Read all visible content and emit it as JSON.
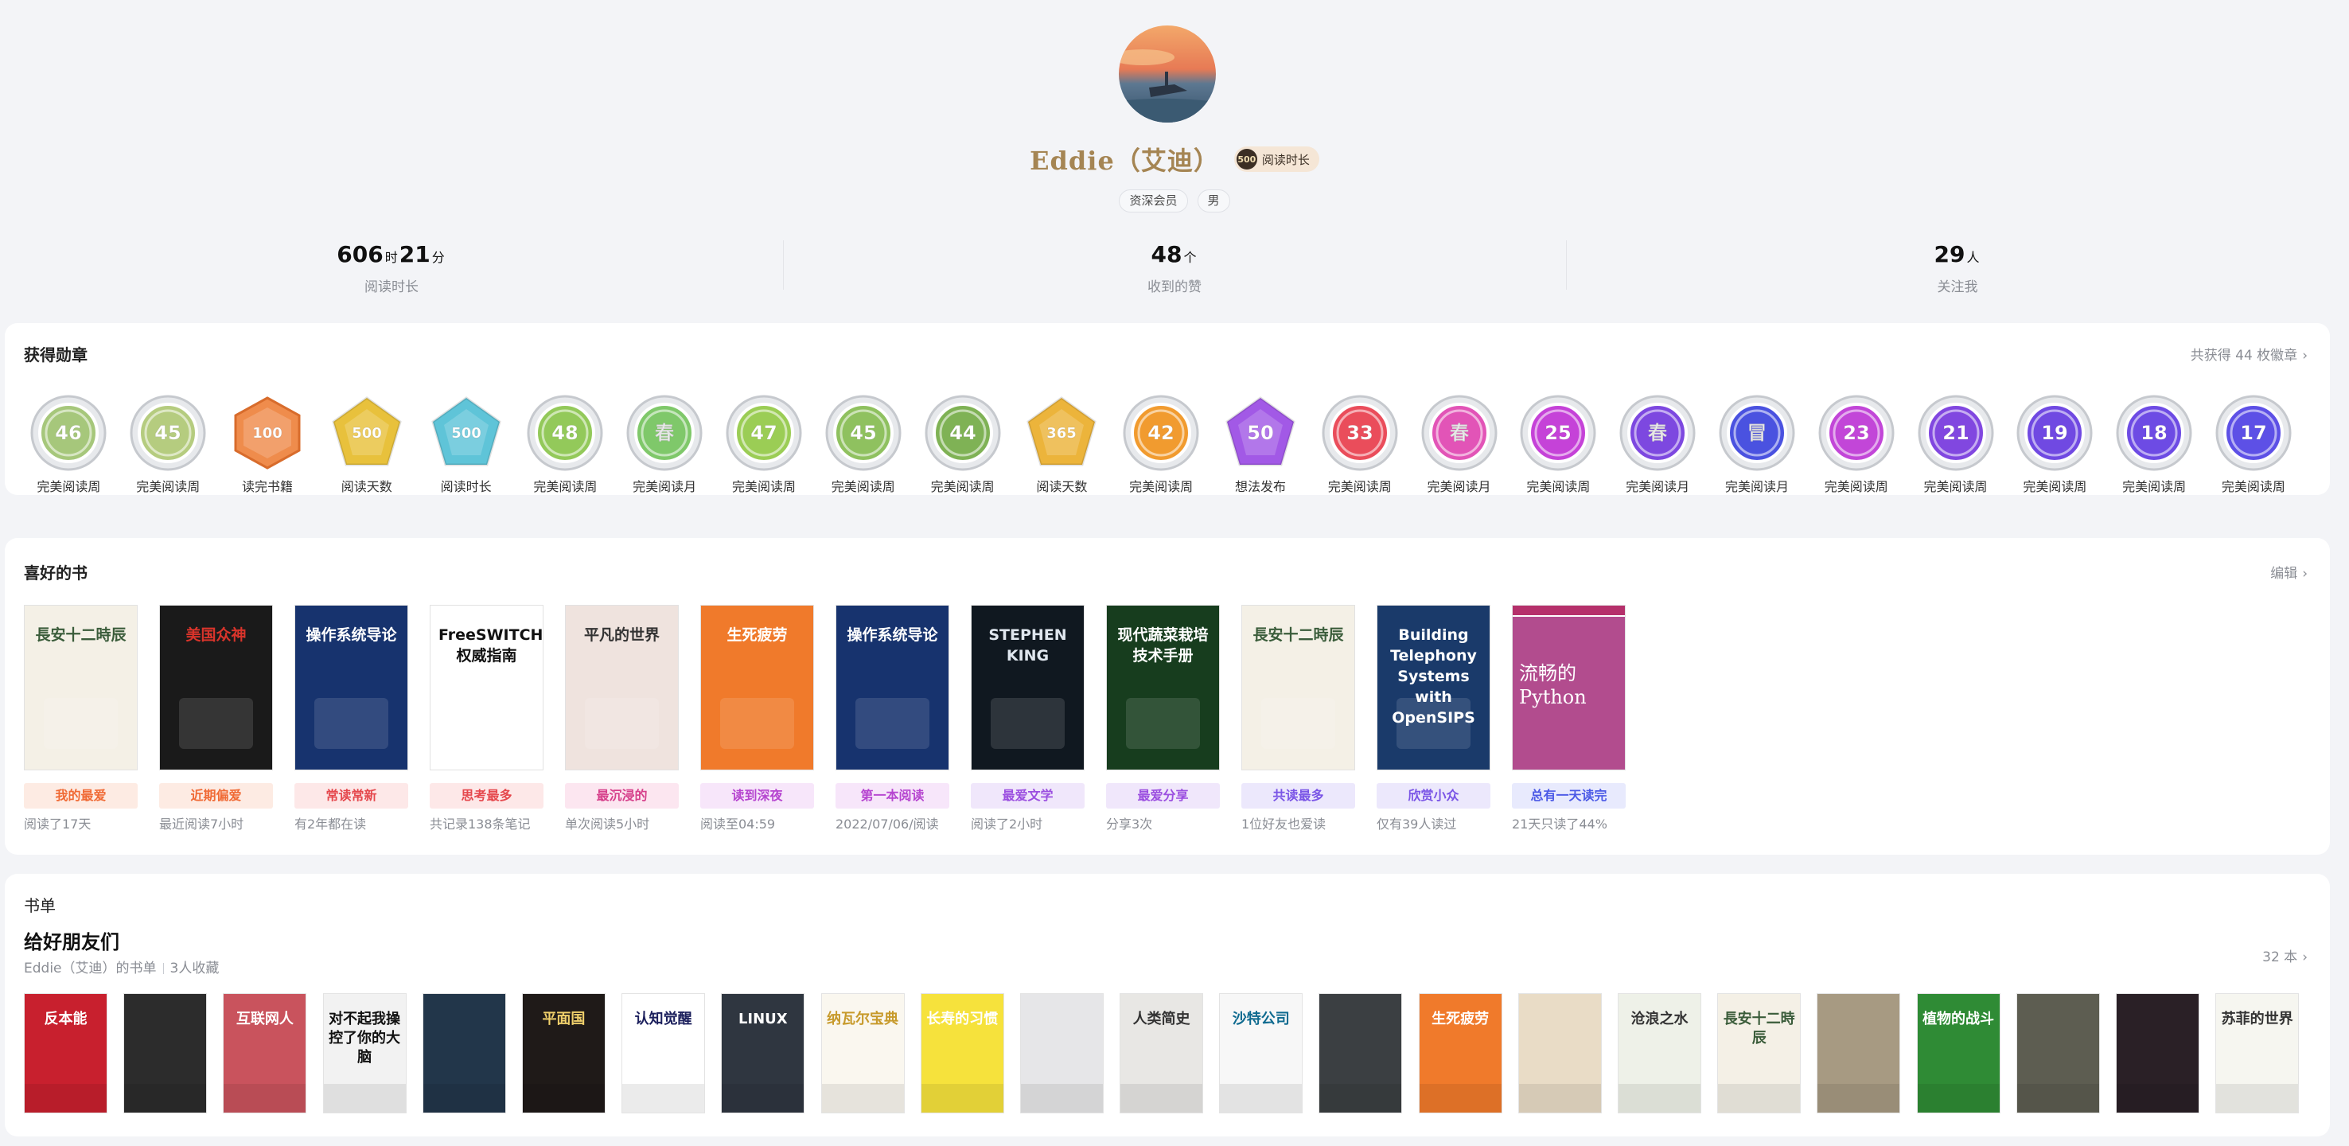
{
  "profile": {
    "name": "Eddie（艾迪）",
    "badge_number": "500",
    "badge_label": "阅读时长",
    "tags": [
      "资深会员",
      "男"
    ]
  },
  "stats": [
    {
      "parts": [
        {
          "v": "606"
        },
        {
          "u": "时"
        },
        {
          "v": "21"
        },
        {
          "u": "分"
        }
      ],
      "label": "阅读时长"
    },
    {
      "parts": [
        {
          "v": "48"
        },
        {
          "u": "个"
        }
      ],
      "label": "收到的赞"
    },
    {
      "parts": [
        {
          "v": "29"
        },
        {
          "u": "人"
        }
      ],
      "label": "关注我"
    }
  ],
  "medals_section": {
    "title": "获得勋章",
    "link": "共获得 44 枚徽章",
    "items": [
      {
        "text": "46",
        "label": "完美阅读周",
        "color": "#a6c77b",
        "shape": "circle"
      },
      {
        "text": "45",
        "label": "完美阅读周",
        "color": "#b5cc7f",
        "shape": "circle"
      },
      {
        "text": "100",
        "label": "读完书籍",
        "color": "#ef8c4c",
        "shape": "hex"
      },
      {
        "text": "500",
        "label": "阅读天数",
        "color": "#e8c13c",
        "shape": "pent"
      },
      {
        "text": "500",
        "label": "阅读时长",
        "color": "#5fc4d8",
        "shape": "pent"
      },
      {
        "text": "48",
        "label": "完美阅读周",
        "color": "#93c95a",
        "shape": "circle"
      },
      {
        "text": "春",
        "label": "完美阅读月",
        "color": "#7fc86a",
        "shape": "circle"
      },
      {
        "text": "47",
        "label": "完美阅读周",
        "color": "#9bcd55",
        "shape": "circle"
      },
      {
        "text": "45",
        "label": "完美阅读周",
        "color": "#8fc15f",
        "shape": "circle"
      },
      {
        "text": "44",
        "label": "完美阅读周",
        "color": "#7fb255",
        "shape": "circle"
      },
      {
        "text": "365",
        "label": "阅读天数",
        "color": "#ecb43b",
        "shape": "pent"
      },
      {
        "text": "42",
        "label": "完美阅读周",
        "color": "#f19b2f",
        "shape": "circle"
      },
      {
        "text": "50",
        "label": "想法发布",
        "color": "#a259e6",
        "shape": "pent"
      },
      {
        "text": "33",
        "label": "完美阅读周",
        "color": "#ea4d5b",
        "shape": "circle"
      },
      {
        "text": "春",
        "label": "完美阅读月",
        "color": "#e254b7",
        "shape": "circle"
      },
      {
        "text": "25",
        "label": "完美阅读周",
        "color": "#c542d8",
        "shape": "circle"
      },
      {
        "text": "春",
        "label": "完美阅读月",
        "color": "#7d48e0",
        "shape": "circle"
      },
      {
        "text": "冒",
        "label": "完美阅读月",
        "color": "#4a52e0",
        "shape": "circle"
      },
      {
        "text": "23",
        "label": "完美阅读周",
        "color": "#c246d8",
        "shape": "circle"
      },
      {
        "text": "21",
        "label": "完美阅读周",
        "color": "#8147e0",
        "shape": "circle"
      },
      {
        "text": "19",
        "label": "完美阅读周",
        "color": "#7049e2",
        "shape": "circle"
      },
      {
        "text": "18",
        "label": "完美阅读周",
        "color": "#6d4be4",
        "shape": "circle"
      },
      {
        "text": "17",
        "label": "完美阅读周",
        "color": "#5d50e6",
        "shape": "circle"
      }
    ]
  },
  "fav_section": {
    "title": "喜好的书",
    "link": "编辑",
    "books": [
      {
        "cover_title": "長安十二時辰",
        "bg": "#f4f0e6",
        "fg": "#3a5c3a",
        "tag": "我的最爱",
        "tag_bg": "#fdebe3",
        "tag_fg": "#f06a35",
        "note": "阅读了17天"
      },
      {
        "cover_title": "美国众神",
        "bg": "#1a1a1a",
        "fg": "#d9342b",
        "tag": "近期偏爱",
        "tag_bg": "#fdebe3",
        "tag_fg": "#f06a35",
        "note": "最近阅读7小时"
      },
      {
        "cover_title": "操作系统导论",
        "bg": "#17336e",
        "fg": "#ffffff",
        "tag": "常读常新",
        "tag_bg": "#fde8e8",
        "tag_fg": "#e5484d",
        "note": "有2年都在读"
      },
      {
        "cover_title": "FreeSWITCH权威指南",
        "bg": "#ffffff",
        "fg": "#111111",
        "tag": "思考最多",
        "tag_bg": "#fde8e8",
        "tag_fg": "#e5484d",
        "note": "共记录138条笔记"
      },
      {
        "cover_title": "平凡的世界",
        "bg": "#efe3de",
        "fg": "#333333",
        "tag": "最沉浸的",
        "tag_bg": "#fce6f0",
        "tag_fg": "#d6408b",
        "note": "单次阅读5小时"
      },
      {
        "cover_title": "生死疲劳",
        "bg": "#f07a2b",
        "fg": "#ffffff",
        "tag": "读到深夜",
        "tag_bg": "#f7e6fa",
        "tag_fg": "#b645d0",
        "note": "阅读至04:59"
      },
      {
        "cover_title": "操作系统导论",
        "bg": "#17336e",
        "fg": "#ffffff",
        "tag": "第一本阅读",
        "tag_bg": "#f7e6fa",
        "tag_fg": "#b645d0",
        "note": "2022/07/06/阅读"
      },
      {
        "cover_title": "STEPHEN KING",
        "bg": "#101820",
        "fg": "#dfe6ee",
        "tag": "最爱文学",
        "tag_bg": "#f0e7fb",
        "tag_fg": "#9b4fe0",
        "note": "阅读了2小时"
      },
      {
        "cover_title": "现代蔬菜栽培技术手册",
        "bg": "#173d1e",
        "fg": "#ffffff",
        "tag": "最爱分享",
        "tag_bg": "#f0e7fb",
        "tag_fg": "#9b4fe0",
        "note": "分享3次"
      },
      {
        "cover_title": "長安十二時辰",
        "bg": "#f4f0e6",
        "fg": "#3a5c3a",
        "tag": "共读最多",
        "tag_bg": "#ece8fc",
        "tag_fg": "#7a55e6",
        "note": "1位好友也爱读"
      },
      {
        "cover_title": "Building Telephony Systems with OpenSIPS",
        "bg": "#1a3a6a",
        "fg": "#ffffff",
        "tag": "欣赏小众",
        "tag_bg": "#ece8fc",
        "tag_fg": "#7a55e6",
        "note": "仅有39人读过"
      },
      {
        "cover_title": "流畅的Python",
        "bg": "#ffffff",
        "fg": "#ffffff",
        "tag": "总有一天读完",
        "tag_bg": "#e8eafd",
        "tag_fg": "#4c5ae6",
        "note": "21天只读了44%"
      }
    ]
  },
  "list_section": {
    "title": "书单",
    "name": "给好朋友们",
    "owner": "Eddie（艾迪）的书单",
    "collect": "3人收藏",
    "link": "32 本",
    "covers": [
      {
        "t": "反本能",
        "bg": "#c8202e",
        "fg": "#ffffff"
      },
      {
        "t": "",
        "bg": "#2c2c2c",
        "fg": "#ffffff"
      },
      {
        "t": "互联网人",
        "bg": "#c9535d",
        "fg": "#ffffff"
      },
      {
        "t": "对不起我操控了你的大脑",
        "bg": "#f2f2f2",
        "fg": "#111111"
      },
      {
        "t": "",
        "bg": "#22364a",
        "fg": "#ffffff"
      },
      {
        "t": "平面国",
        "bg": "#1f1a18",
        "fg": "#f0d06b"
      },
      {
        "t": "认知觉醒",
        "bg": "#ffffff",
        "fg": "#1b1f5c"
      },
      {
        "t": "LINUX",
        "bg": "#2f3640",
        "fg": "#ffffff"
      },
      {
        "t": "纳瓦尔宝典",
        "bg": "#faf7ef",
        "fg": "#c79a2b"
      },
      {
        "t": "长寿的习惯",
        "bg": "#f6e23c",
        "fg": "#ffffff"
      },
      {
        "t": "",
        "bg": "#e6e6e8",
        "fg": "#555555"
      },
      {
        "t": "人类简史",
        "bg": "#e8e7e4",
        "fg": "#333333"
      },
      {
        "t": "沙特公司",
        "bg": "#f7f7f7",
        "fg": "#0e6a8f"
      },
      {
        "t": "",
        "bg": "#3b3f42",
        "fg": "#e04b3c"
      },
      {
        "t": "生死疲劳",
        "bg": "#f07a2b",
        "fg": "#ffffff"
      },
      {
        "t": "",
        "bg": "#e9dcc6",
        "fg": "#6c5a3c"
      },
      {
        "t": "沧浪之水",
        "bg": "#eef1e8",
        "fg": "#333333"
      },
      {
        "t": "長安十二時辰",
        "bg": "#f4f0e6",
        "fg": "#3a5c3a"
      },
      {
        "t": "",
        "bg": "#a79a82",
        "fg": "#ffffff"
      },
      {
        "t": "植物的战斗",
        "bg": "#2f8b35",
        "fg": "#ffffff"
      },
      {
        "t": "",
        "bg": "#5d5d51",
        "fg": "#ffffff"
      },
      {
        "t": "",
        "bg": "#2a2026",
        "fg": "#ffffff"
      },
      {
        "t": "苏菲的世界",
        "bg": "#f6f6f0",
        "fg": "#333333"
      }
    ]
  }
}
